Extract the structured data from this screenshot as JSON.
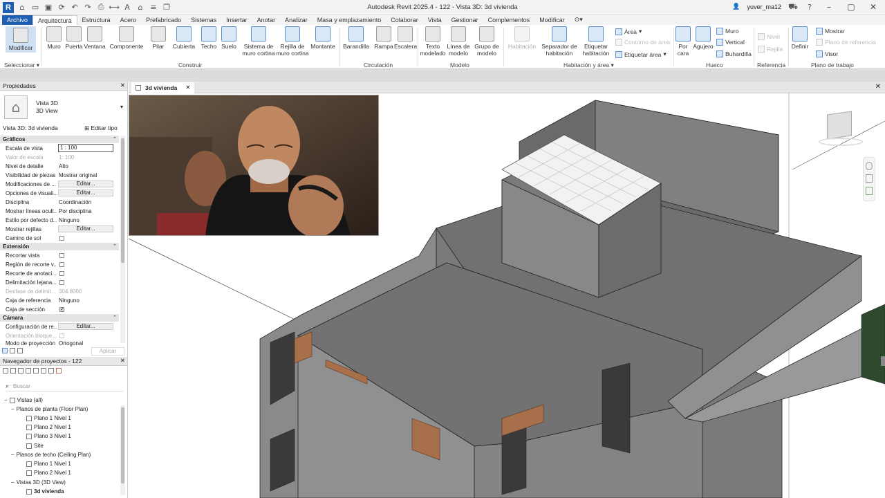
{
  "window": {
    "title": "Autodesk Revit 2025.4 - 122 - Vista 3D: 3d vivienda",
    "user": "yuver_ma12"
  },
  "colors": {
    "accent": "#1e5fb3"
  },
  "tabs": [
    "Archivo",
    "Arquitectura",
    "Estructura",
    "Acero",
    "Prefabricado",
    "Sistemas",
    "Insertar",
    "Anotar",
    "Analizar",
    "Masa y emplazamiento",
    "Colaborar",
    "Vista",
    "Gestionar",
    "Complementos",
    "Modificar"
  ],
  "ribbon": {
    "modify": "Modificar",
    "select": "Seleccionar",
    "build": [
      "Muro",
      "Puerta",
      "Ventana",
      "Componente",
      "Pilar",
      "Cubierta",
      "Techo",
      "Suelo",
      "Sistema de muro cortina",
      "Rejilla de muro cortina",
      "Montante"
    ],
    "build_group": "Construir",
    "circ": [
      "Barandilla",
      "Rampa",
      "Escalera"
    ],
    "circ_group": "Circulación",
    "model": [
      "Texto modelado",
      "Línea de modelo",
      "Grupo de modelo"
    ],
    "model_group": "Modelo",
    "room": [
      "Habitación",
      "Separador de habitación",
      "Etiquetar habitación"
    ],
    "area": "Área",
    "area_boundary": "Contorno de área",
    "area_tag": "Etiquetar área",
    "room_group": "Habitación y área",
    "opening": [
      "Por cara",
      "Agujero"
    ],
    "wall": "Muro",
    "vertical": "Vertical",
    "dormer": "Buhardilla",
    "opening_group": "Hueco",
    "datum": [
      "Nivel",
      "Rejilla"
    ],
    "datum_group": "Referencia",
    "work": "Definir",
    "show": "Mostrar",
    "ref_plane": "Plano de referencia",
    "viewer": "Visor",
    "work_group": "Plano de trabajo"
  },
  "properties": {
    "title": "Propiedades",
    "type1": "Vista 3D",
    "type2": "3D View",
    "instance": "Vista 3D: 3d vivienda",
    "edit_type": "Editar tipo",
    "cat_graphics": "Gráficos",
    "cat_extent": "Extensión",
    "cat_camera": "Cámara",
    "rows": [
      {
        "k": "Escala de vista",
        "v": "1 : 100"
      },
      {
        "k": "Valor de escala",
        "v": "1:   100"
      },
      {
        "k": "Nivel de detalle",
        "v": "Alto"
      },
      {
        "k": "Visibilidad de piezas",
        "v": "Mostrar original"
      },
      {
        "k": "Modificaciones de ...",
        "v": "Editar..."
      },
      {
        "k": "Opciones de visuali...",
        "v": "Editar..."
      },
      {
        "k": "Disciplina",
        "v": "Coordinación"
      },
      {
        "k": "Mostrar líneas ocult...",
        "v": "Por disciplina"
      },
      {
        "k": "Estilo por defecto d...",
        "v": "Ninguno"
      },
      {
        "k": "Mostrar rejillas",
        "v": "Editar..."
      },
      {
        "k": "Camino de sol",
        "v": ""
      }
    ],
    "extent_rows": [
      {
        "k": "Recortar vista"
      },
      {
        "k": "Región de recorte v..."
      },
      {
        "k": "Recorte de anotaci..."
      },
      {
        "k": "Delimitación lejana..."
      },
      {
        "k": "Desfase de delimit...",
        "v": "304.8000"
      },
      {
        "k": "Caja de referencia",
        "v": "Ninguno"
      },
      {
        "k": "Caja de sección"
      }
    ],
    "camera_rows": [
      {
        "k": "Configuración de re...",
        "v": "Editar..."
      },
      {
        "k": "Orientación bloque..."
      },
      {
        "k": "Modo de proyección",
        "v": "Ortogonal"
      }
    ],
    "apply": "Aplicar"
  },
  "navigator": {
    "title": "Navegador de proyectos - 122",
    "search": "Buscar",
    "tree": [
      {
        "t": "Vistas (all)",
        "d": 0
      },
      {
        "t": "Planos de planta (Floor Plan)",
        "d": 1
      },
      {
        "t": "Plano 1 Nivel 1",
        "d": 2
      },
      {
        "t": "Plano 2 Nivel 1",
        "d": 2
      },
      {
        "t": "Plano 3 Nivel 1",
        "d": 2
      },
      {
        "t": "Site",
        "d": 2
      },
      {
        "t": "Planos de techo (Ceiling Plan)",
        "d": 1
      },
      {
        "t": "Plano 1 Nivel 1",
        "d": 2
      },
      {
        "t": "Plano 2 Nivel 1",
        "d": 2
      },
      {
        "t": "Vistas 3D (3D View)",
        "d": 1
      },
      {
        "t": "3d vivienda",
        "d": 2
      }
    ]
  },
  "view_tab": "3d vivienda"
}
